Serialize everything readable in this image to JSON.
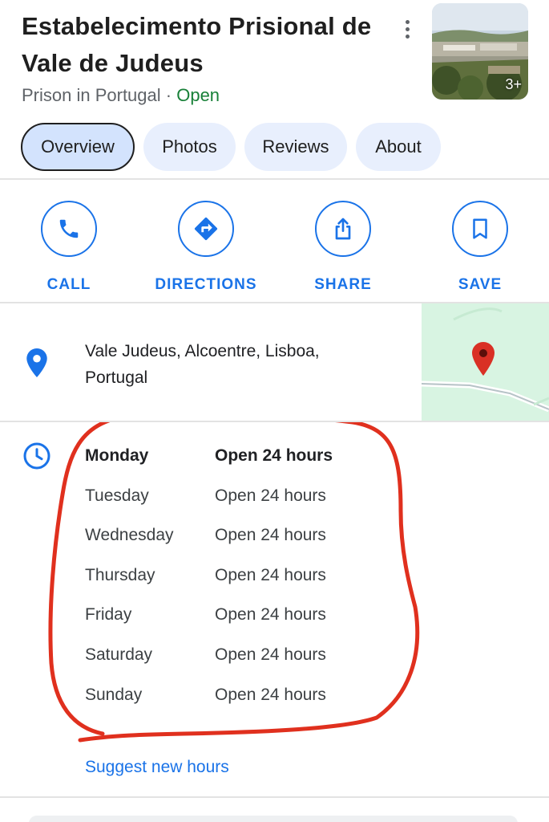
{
  "place": {
    "name": "Estabelecimento Prisional de Vale de Judeus",
    "name_line1": "Estabelecimento Prisional de",
    "name_line2": "Vale de Judeus",
    "category": "Prison in Portugal",
    "separator": " · ",
    "status": "Open",
    "photo_count": "3+"
  },
  "tabs": [
    {
      "label": "Overview",
      "active": true
    },
    {
      "label": "Photos",
      "active": false
    },
    {
      "label": "Reviews",
      "active": false
    },
    {
      "label": "About",
      "active": false
    }
  ],
  "actions": [
    {
      "label": "CALL",
      "icon": "phone-icon"
    },
    {
      "label": "DIRECTIONS",
      "icon": "directions-icon"
    },
    {
      "label": "SHARE",
      "icon": "share-icon"
    },
    {
      "label": "SAVE",
      "icon": "bookmark-icon"
    }
  ],
  "address": {
    "line1": "Vale Judeus, Alcoentre, Lisboa,",
    "line2": "Portugal"
  },
  "hours": [
    {
      "day": "Monday",
      "time": "Open 24 hours",
      "current": true
    },
    {
      "day": "Tuesday",
      "time": "Open 24 hours",
      "current": false
    },
    {
      "day": "Wednesday",
      "time": "Open 24 hours",
      "current": false
    },
    {
      "day": "Thursday",
      "time": "Open 24 hours",
      "current": false
    },
    {
      "day": "Friday",
      "time": "Open 24 hours",
      "current": false
    },
    {
      "day": "Saturday",
      "time": "Open 24 hours",
      "current": false
    },
    {
      "day": "Sunday",
      "time": "Open 24 hours",
      "current": false
    }
  ],
  "suggest_label": "Suggest new hours",
  "colors": {
    "accent": "#1a73e8",
    "open_status": "#188038",
    "tab_bg": "#e8effd",
    "tab_active_bg": "#d3e3fd",
    "annotation": "#e0301e",
    "map_pin": "#d93025"
  }
}
